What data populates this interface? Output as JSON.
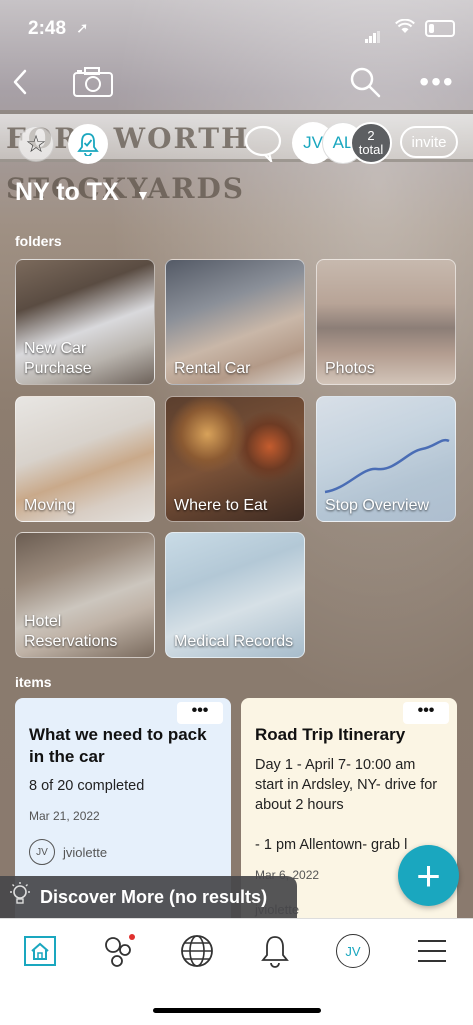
{
  "status_bar": {
    "time": "2:48",
    "location_icon": "location-arrow-icon",
    "wifi_icon": "wifi-icon",
    "battery_icon": "battery-icon"
  },
  "toolbar": {
    "back_icon": "chevron-left-icon",
    "camera_icon": "camera-icon",
    "search_icon": "search-icon",
    "more_icon": "more-dots-icon",
    "more_label": "•••"
  },
  "banner": {
    "text": "FORT WORTH STOCKYARDS"
  },
  "members": {
    "avatar1": "JV",
    "avatar2": "AL",
    "total_count": "2",
    "total_label": "total",
    "invite_label": "invite"
  },
  "project": {
    "name": "NY to TX",
    "caret": "▼"
  },
  "folders_heading": "folders",
  "folders": [
    {
      "label": "New Car Purchase",
      "line1": "New Car",
      "line2": "Purchase"
    },
    {
      "label": "Rental Car",
      "line1": "",
      "line2": "Rental Car"
    },
    {
      "label": "Photos",
      "line1": "",
      "line2": "Photos"
    },
    {
      "label": "Moving",
      "line1": "",
      "line2": "Moving"
    },
    {
      "label": "Where to Eat",
      "line1": "",
      "line2": "Where to Eat"
    },
    {
      "label": "Stop Overview",
      "line1": "",
      "line2": "Stop Overview"
    },
    {
      "label": "Hotel Reservations",
      "line1": "Hotel",
      "line2": "Reservations"
    },
    {
      "label": "Medical Records",
      "line1": "",
      "line2": "Medical Records"
    }
  ],
  "items_heading": "items",
  "items": [
    {
      "title": "What we need to pack in the car",
      "body": "8 of 20 completed",
      "date": "Mar 21, 2022",
      "author_initials": "JV",
      "author": "jviolette",
      "dots": "•••"
    },
    {
      "title": "Road Trip Itinerary",
      "body": "Day 1 - April 7- 10:00 am start in Ardsley, NY- drive for about 2 hours\n\n- 1 pm Allentown- grab l",
      "date": "Mar 6, 2022",
      "author": "jviolette",
      "dots": "•••"
    }
  ],
  "fab_label": "+",
  "discover": {
    "label": "Discover More (no results)"
  },
  "bottom_nav": [
    {
      "name": "home",
      "icon": "home-icon"
    },
    {
      "name": "network",
      "icon": "network-icon"
    },
    {
      "name": "explore",
      "icon": "globe-icon"
    },
    {
      "name": "notifications",
      "icon": "bell-icon"
    },
    {
      "name": "profile",
      "icon": "profile-icon",
      "label": "JV"
    },
    {
      "name": "menu",
      "icon": "hamburger-icon"
    }
  ],
  "colors": {
    "accent": "#1aa7bf",
    "discover_bg": "#46464a"
  }
}
